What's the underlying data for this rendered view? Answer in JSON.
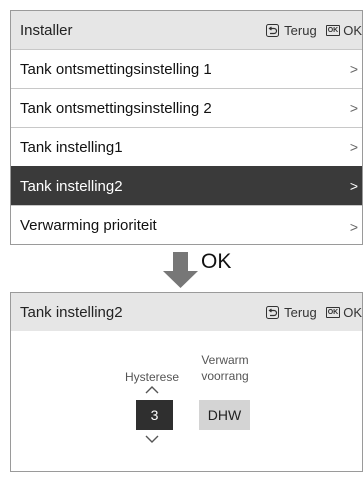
{
  "screen1": {
    "title": "Installer",
    "back_label": "Terug",
    "ok_icon": "OK",
    "ok_label": "OK",
    "items": [
      {
        "label": "Tank ontsmettingsinstelling 1",
        "selected": false
      },
      {
        "label": "Tank ontsmettingsinstelling 2",
        "selected": false
      },
      {
        "label": "Tank instelling1",
        "selected": false
      },
      {
        "label": "Tank instelling2",
        "selected": true
      },
      {
        "label": "Verwarming prioriteit",
        "selected": false
      }
    ]
  },
  "transition": {
    "label": "OK",
    "arrow_icon": "down-arrow-icon"
  },
  "screen2": {
    "title": "Tank instelling2",
    "back_label": "Terug",
    "ok_icon": "OK",
    "ok_label": "OK",
    "hysterese_label": "Hysterese",
    "hysterese_value": "3",
    "verwarm_label_1": "Verwarm",
    "verwarm_label_2": "voorrang",
    "verwarm_value": "DHW"
  },
  "colors": {
    "header_bg": "#e6e6e6",
    "selected_bg": "#3a3a3a",
    "arrow": "#777777",
    "hys_box": "#2f2f2f",
    "dhw_box": "#d4d4d4"
  }
}
